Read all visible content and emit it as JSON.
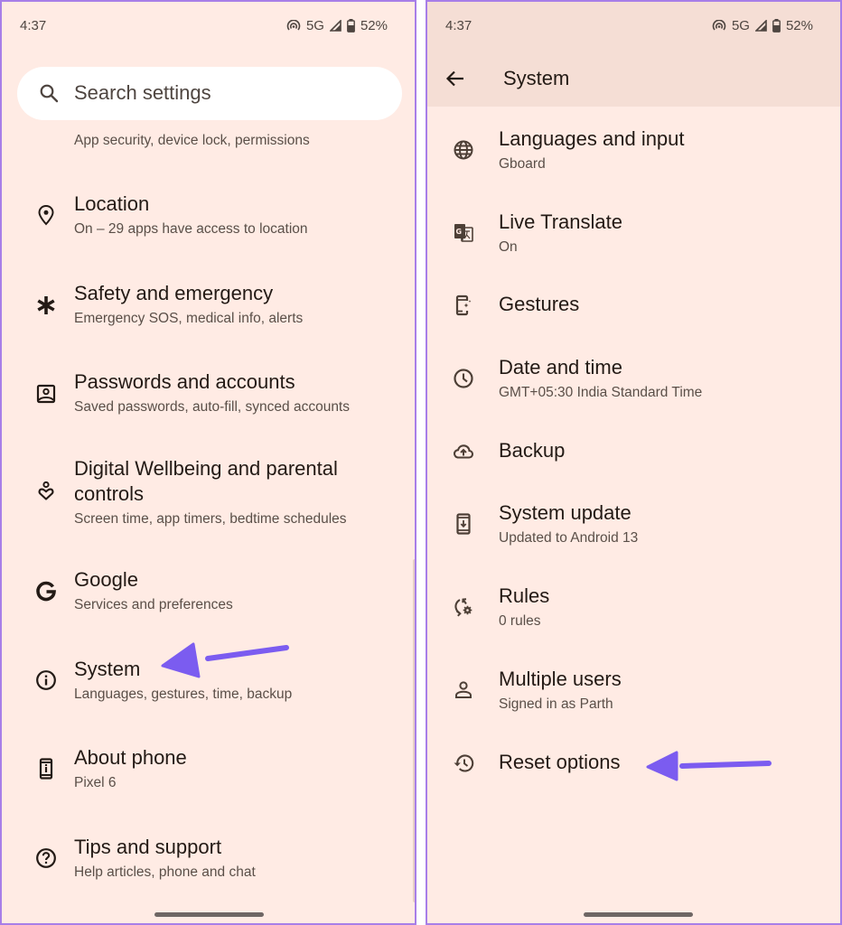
{
  "status_bar": {
    "time": "4:37",
    "network": "5G",
    "battery": "52%",
    "icons": [
      "hotspot-icon",
      "signal-icon",
      "battery-icon"
    ]
  },
  "left_screen": {
    "search": {
      "placeholder": "Search settings",
      "icon": "search-icon"
    },
    "partial_item_subtitle": "App security, device lock, permissions",
    "items": [
      {
        "title": "Location",
        "subtitle": "On – 29 apps have access to location",
        "icon": "location-pin-icon"
      },
      {
        "title": "Safety and emergency",
        "subtitle": "Emergency SOS, medical info, alerts",
        "icon": "asterisk-icon"
      },
      {
        "title": "Passwords and accounts",
        "subtitle": "Saved passwords, auto-fill, synced accounts",
        "icon": "account-box-icon"
      },
      {
        "title": "Digital Wellbeing and parental",
        "title_line2": "controls",
        "subtitle": "Screen time, app timers, bedtime schedules",
        "icon": "wellbeing-heart-icon"
      },
      {
        "title": "Google",
        "subtitle": "Services and preferences",
        "icon": "google-g-icon"
      },
      {
        "title": "System",
        "subtitle": "Languages, gestures, time, backup",
        "icon": "info-icon"
      },
      {
        "title": "About phone",
        "subtitle": "Pixel 6",
        "icon": "phone-info-icon"
      },
      {
        "title": "Tips and support",
        "subtitle": "Help articles, phone and chat",
        "icon": "help-icon"
      }
    ],
    "annotation_target": "System"
  },
  "right_screen": {
    "app_bar": {
      "title": "System",
      "back_icon": "back-arrow-icon"
    },
    "items": [
      {
        "title": "Languages and input",
        "subtitle": "Gboard",
        "icon": "globe-icon"
      },
      {
        "title": "Live Translate",
        "subtitle": "On",
        "icon": "translate-icon"
      },
      {
        "title": "Gestures",
        "subtitle": "",
        "icon": "gestures-phone-icon"
      },
      {
        "title": "Date and time",
        "subtitle": "GMT+05:30 India Standard Time",
        "icon": "clock-icon"
      },
      {
        "title": "Backup",
        "subtitle": "",
        "icon": "cloud-upload-icon"
      },
      {
        "title": "System update",
        "subtitle": "Updated to Android 13",
        "icon": "system-update-icon"
      },
      {
        "title": "Rules",
        "subtitle": "0 rules",
        "icon": "rules-icon"
      },
      {
        "title": "Multiple users",
        "subtitle": "Signed in as Parth",
        "icon": "person-icon"
      },
      {
        "title": "Reset options",
        "subtitle": "",
        "icon": "history-icon"
      }
    ],
    "annotation_target": "Reset options"
  },
  "colors": {
    "background": "#ffebe4",
    "app_bar": "#f5ded5",
    "border": "#a77ee8",
    "annotation_arrow": "#7b5cf0",
    "text_primary": "#231a15",
    "text_secondary": "#5a4f48"
  }
}
